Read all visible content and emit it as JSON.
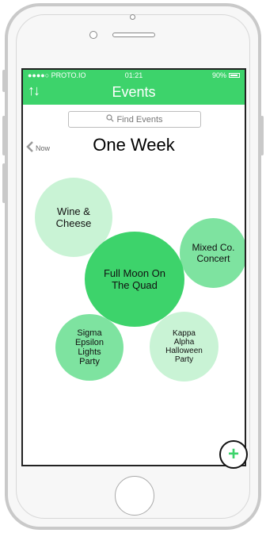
{
  "status_bar": {
    "carrier": "●●●●○ PROTO.IO",
    "time": "01:21",
    "battery": "90%"
  },
  "nav": {
    "title": "Events",
    "sort_icon": "↑↓"
  },
  "search": {
    "placeholder": "Find Events",
    "icon": "search-icon"
  },
  "back": {
    "label": "Now",
    "icon": "chevron-left-icon"
  },
  "header": {
    "title": "One Week"
  },
  "events": [
    {
      "name": "Wine & Cheese"
    },
    {
      "name": "Mixed Co. Concert"
    },
    {
      "name": "Full Moon On The Quad"
    },
    {
      "name": "Sigma Epsilon Lights Party"
    },
    {
      "name": "Kappa Alpha Halloween Party"
    }
  ],
  "fab": {
    "label": "+",
    "icon": "plus-icon"
  },
  "colors": {
    "accent": "#3dd36b",
    "bubble_light": "#c9f3d5",
    "bubble_mid": "#7ee3a0",
    "bubble_dark": "#3dd36b"
  }
}
